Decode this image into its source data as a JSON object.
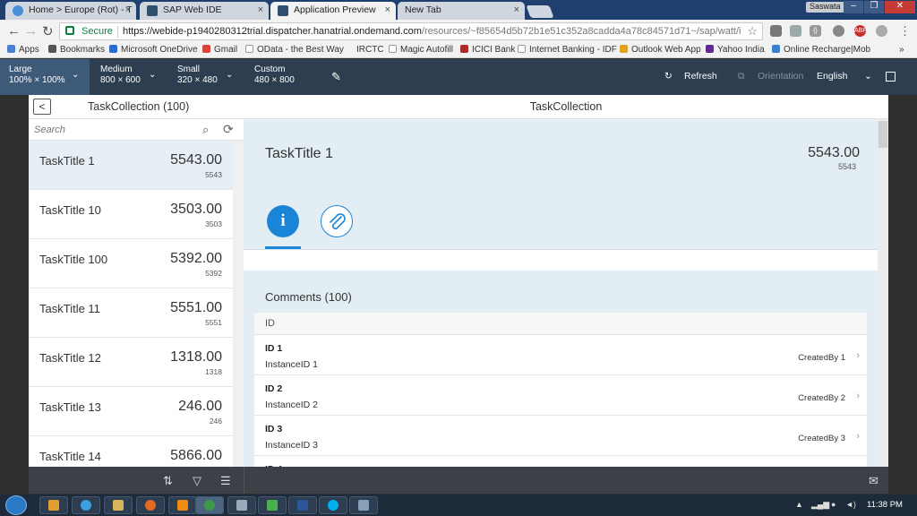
{
  "browser": {
    "tabs": [
      {
        "label": "Home > Europe (Rot) - T",
        "icon": "cloud-icon"
      },
      {
        "label": "SAP Web IDE",
        "icon": "sap-icon"
      },
      {
        "label": "Application Preview",
        "icon": "sap-icon"
      },
      {
        "label": "New Tab",
        "icon": ""
      }
    ],
    "user": "Saswata",
    "security_label": "Secure",
    "url_main": "https://webide-p1940280312trial.dispatcher.hanatrial.ondemand.com",
    "url_rest": "/resources/~f85654d5b72b1e51c352a8cadda4a78c84571d71~/sap/watt/ideplatfc",
    "bookmarks": [
      "Apps",
      "Bookmarks",
      "Microsoft OneDrive",
      "Gmail",
      "OData - the Best Way",
      "IRCTC",
      "Magic Autofill",
      "ICICI Bank",
      "Internet Banking - IDF",
      "Outlook Web App",
      "Yahoo India",
      "Online Recharge|Mob"
    ],
    "bookmarks_more": "»"
  },
  "preview_bar": {
    "devices": [
      {
        "name": "Large",
        "size": "100% × 100%"
      },
      {
        "name": "Medium",
        "size": "800 × 600"
      },
      {
        "name": "Small",
        "size": "320 × 480"
      },
      {
        "name": "Custom",
        "size": "480 × 800"
      }
    ],
    "refresh": "Refresh",
    "orientation": "Orientation",
    "language": "English"
  },
  "master": {
    "title": "TaskCollection (100)",
    "search_placeholder": "Search",
    "items": [
      {
        "title": "TaskTitle 1",
        "number": "5543.00",
        "sub": "5543"
      },
      {
        "title": "TaskTitle 10",
        "number": "3503.00",
        "sub": "3503"
      },
      {
        "title": "TaskTitle 100",
        "number": "5392.00",
        "sub": "5392"
      },
      {
        "title": "TaskTitle 11",
        "number": "5551.00",
        "sub": "5551"
      },
      {
        "title": "TaskTitle 12",
        "number": "1318.00",
        "sub": "1318"
      },
      {
        "title": "TaskTitle 13",
        "number": "246.00",
        "sub": "246"
      },
      {
        "title": "TaskTitle 14",
        "number": "5866.00",
        "sub": "5866"
      }
    ]
  },
  "detail": {
    "title": "TaskCollection",
    "object_title": "TaskTitle 1",
    "object_number": "5543.00",
    "object_sub": "5543",
    "info_tab_glyph": "i",
    "comments_title": "Comments (100)",
    "column_header": "ID",
    "rows": [
      {
        "id": "ID 1",
        "instance": "InstanceID 1",
        "created_by": "CreatedBy 1"
      },
      {
        "id": "ID 2",
        "instance": "InstanceID 2",
        "created_by": "CreatedBy 2"
      },
      {
        "id": "ID 3",
        "instance": "InstanceID 3",
        "created_by": "CreatedBy 3"
      },
      {
        "id": "ID 4",
        "instance": "",
        "created_by": ""
      }
    ]
  },
  "taskbar": {
    "clock": "11:38 PM"
  },
  "colors": {
    "accent": "#1a85d6",
    "preview_bar": "#2c3e50",
    "object_header": "#e2eef3",
    "footer": "#3c4148"
  }
}
